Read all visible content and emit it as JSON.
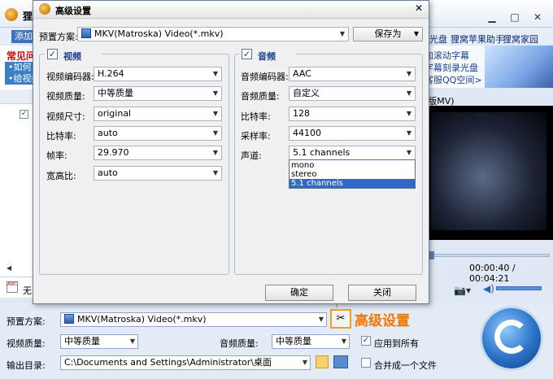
{
  "main": {
    "title": "狸",
    "menu": {
      "add": "添加",
      "links": [
        "光盘",
        "狸窝苹果助手",
        "狸窝家园"
      ]
    },
    "faq": {
      "title": "常见问",
      "lines": [
        "•如何",
        "•给视频"
      ]
    },
    "ad": {
      "lines": [
        "加滚动字幕",
        "字幕刻录光盘",
        "客服QQ空间>"
      ]
    },
    "mv_label": "(版MV)",
    "time": "00:00:40 / 00:04:21",
    "subtitle_none": "无"
  },
  "bottom": {
    "preset_label": "预置方案:",
    "preset_value": "MKV(Matroska) Video(*.mkv)",
    "video_quality_label": "视频质量:",
    "video_quality_value": "中等质量",
    "audio_quality_label": "音频质量:",
    "audio_quality_value": "中等质量",
    "apply_all_label": "应用到所有",
    "apply_all_checked": true,
    "output_label": "输出目录:",
    "output_value": "C:\\Documents and Settings\\Administrator\\桌面",
    "merge_label": "合并成一个文件",
    "merge_checked": false,
    "callout": "高级设置"
  },
  "dialog": {
    "title": "高级设置",
    "preset_label": "预置方案:",
    "preset_value": "MKV(Matroska) Video(*.mkv)",
    "save_as": "保存为",
    "video": {
      "title": "视频",
      "enabled": true,
      "fields": [
        {
          "label": "视频编码器:",
          "value": "H.264"
        },
        {
          "label": "视频质量:",
          "value": "中等质量"
        },
        {
          "label": "视频尺寸:",
          "value": "original"
        },
        {
          "label": "比特率:",
          "value": "auto"
        },
        {
          "label": "帧率:",
          "value": "29.970"
        },
        {
          "label": "宽高比:",
          "value": "auto"
        }
      ]
    },
    "audio": {
      "title": "音频",
      "enabled": true,
      "fields": [
        {
          "label": "音频编码器:",
          "value": "AAC"
        },
        {
          "label": "音频质量:",
          "value": "自定义"
        },
        {
          "label": "比特率:",
          "value": "128"
        },
        {
          "label": "采样率:",
          "value": "44100"
        },
        {
          "label": "声道:",
          "value": "5.1 channels"
        }
      ],
      "channel_options": [
        "mono",
        "stereo",
        "5.1 channels"
      ],
      "channel_selected": "5.1 channels"
    },
    "ok": "确定",
    "close": "关闭"
  },
  "icons": {
    "app": "fox-logo-icon",
    "close": "close-icon",
    "minimize": "minimize-icon",
    "maximize": "maximize-icon",
    "dropdown": "chevron-down-icon",
    "settings": "wrench-icon",
    "folder": "folder-icon",
    "convert": "convert-icon"
  },
  "colors": {
    "accent": "#316ac5",
    "callout": "#f07800",
    "group_title": "#1a3d8a"
  }
}
